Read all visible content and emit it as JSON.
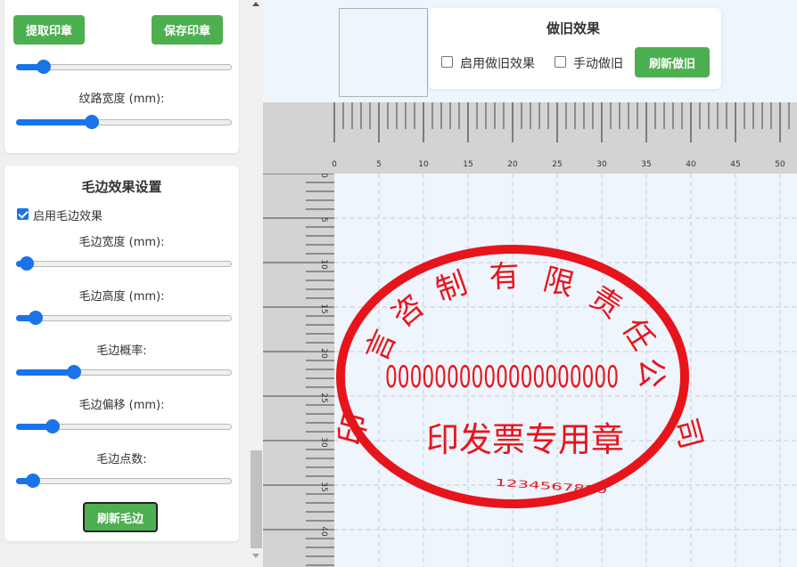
{
  "sidebar": {
    "panel_top": {
      "extract_button": "提取印章",
      "save_button": "保存印章",
      "slider1_value": 0.13,
      "texture_width_label": "纹路宽度 (mm):",
      "texture_width_value": 0.35
    },
    "panel_edge": {
      "title": "毛边效果设置",
      "enable_label": "启用毛边效果",
      "enable_checked": true,
      "width_label": "毛边宽度 (mm):",
      "width_value": 0.05,
      "height_label": "毛边高度 (mm):",
      "height_value": 0.09,
      "probability_label": "毛边概率:",
      "probability_value": 0.27,
      "offset_label": "毛边偏移 (mm):",
      "offset_value": 0.17,
      "points_label": "毛边点数:",
      "points_value": 0.08,
      "refresh_button": "刷新毛边"
    }
  },
  "aging": {
    "title": "做旧效果",
    "enable_label": "启用做旧效果",
    "manual_label": "手动做旧",
    "refresh_button": "刷新做旧"
  },
  "ruler": {
    "top_labels": [
      "0",
      "5",
      "10",
      "15",
      "20",
      "25",
      "30",
      "35",
      "40",
      "45",
      "50"
    ],
    "left_labels": [
      "0",
      "5",
      "10",
      "15",
      "20",
      "25",
      "30",
      "35",
      "40"
    ]
  },
  "stamp": {
    "color": "#e8141c",
    "arc_text": [
      "言",
      "咨",
      "制",
      "有",
      "限",
      "责",
      "任",
      "公"
    ],
    "number_text": "0000000000000000000",
    "bottom_text": "印发票专用章",
    "serial_text": "1234567890",
    "end_glyph": "司"
  },
  "colors": {
    "accent_green": "#4caf50",
    "slider_blue": "#1a73e8"
  }
}
